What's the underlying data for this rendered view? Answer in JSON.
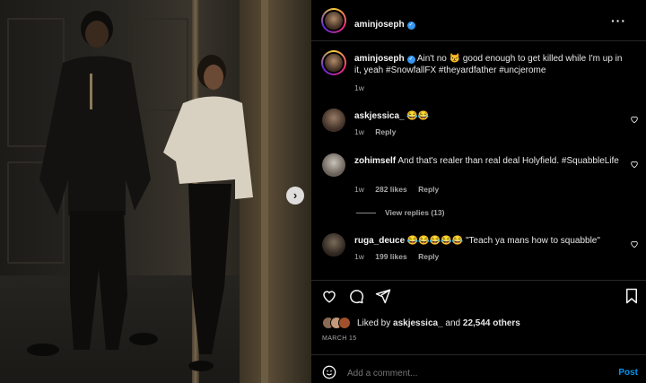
{
  "post": {
    "author": "aminjoseph",
    "caption_user": "aminjoseph",
    "caption_text": "Ain't no 😾 good enough to get killed while I'm up in it, yeah #SnowfallFX #theyardfather #uncjerome",
    "caption_time": "1w"
  },
  "comments": [
    {
      "user": "askjessica_",
      "text": "😂😂",
      "time": "1w",
      "likes": "",
      "reply": "Reply"
    },
    {
      "user": "zohimself",
      "text": "And that's realer than real deal Holyfield. #SquabbleLife",
      "time": "1w",
      "likes": "282 likes",
      "reply": "Reply",
      "view_replies": "View replies (13)"
    },
    {
      "user": "ruga_deuce",
      "text": "😂😂😂😂😂 \"Teach ya mans how to squabble\"",
      "time": "1w",
      "likes": "199 likes",
      "reply": "Reply"
    }
  ],
  "likes": {
    "prefix": "Liked by ",
    "user": "askjessica_",
    "mid": " and ",
    "count": "22,544 others"
  },
  "date": "MARCH 15",
  "comment_box": {
    "placeholder": "Add a comment...",
    "post_label": "Post"
  },
  "icons": {
    "more": "more-options-icon",
    "next": "chevron-right-icon",
    "like": "heart-icon",
    "comment": "comment-icon",
    "share": "paper-plane-icon",
    "save": "bookmark-icon",
    "emoji": "emoji-icon"
  },
  "colors": {
    "verified": "#3897f0",
    "post": "#0095f6",
    "background": "#000000"
  }
}
